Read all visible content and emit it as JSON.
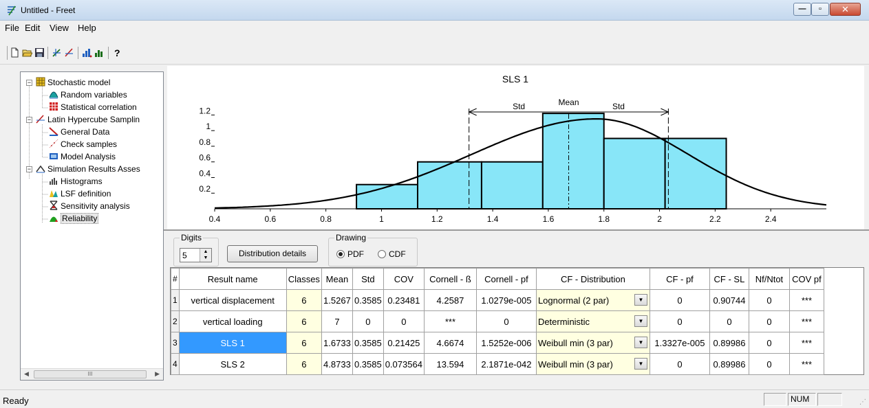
{
  "window": {
    "title": "Untitled - Freet",
    "minimize_glyph": "—",
    "maximize_glyph": "▫",
    "close_glyph": "✕"
  },
  "menu": [
    "File",
    "Edit",
    "View",
    "Help"
  ],
  "toolbar": {
    "icons": [
      "new-file-icon",
      "open-folder-icon",
      "save-disk-icon",
      "lhs-sampling-icon",
      "check-samples-icon",
      "histogram-icon",
      "sensitivity-icon",
      "help-icon"
    ]
  },
  "tree": {
    "items": [
      {
        "label": "Stochastic model",
        "icon": "grid-table-icon"
      },
      {
        "label": "Random variables",
        "icon": "pdf-curve-icon"
      },
      {
        "label": "Statistical correlation",
        "icon": "correlation-matrix-icon"
      },
      {
        "label": "Latin Hypercube Samplin",
        "icon": "lhs-icon"
      },
      {
        "label": "General Data",
        "icon": "general-data-icon"
      },
      {
        "label": "Check samples",
        "icon": "scatter-icon"
      },
      {
        "label": "Model Analysis",
        "icon": "model-analysis-icon"
      },
      {
        "label": "Simulation Results Asses",
        "icon": "results-icon"
      },
      {
        "label": "Histograms",
        "icon": "histogram-icon"
      },
      {
        "label": "LSF definition",
        "icon": "lsf-icon"
      },
      {
        "label": "Sensitivity analysis",
        "icon": "sensitivity-icon"
      },
      {
        "label": "Reliability",
        "icon": "reliability-icon"
      }
    ],
    "scroll_thumb": "III"
  },
  "chart_data": {
    "type": "bar",
    "title": "SLS 1",
    "xlim": [
      0.4,
      2.6
    ],
    "ylim": [
      0,
      1.3
    ],
    "x_ticks": [
      "0.4",
      "0.6",
      "0.8",
      "1",
      "1.2",
      "1.4",
      "1.6",
      "1.8",
      "2",
      "2.2",
      "2.4"
    ],
    "y_ticks": [
      "0.2",
      "0.4",
      "0.6",
      "0.8",
      "1",
      "1.2"
    ],
    "bins": [
      {
        "x0": 0.91,
        "x1": 1.13,
        "height": 0.31
      },
      {
        "x0": 1.13,
        "x1": 1.36,
        "height": 0.6
      },
      {
        "x0": 1.36,
        "x1": 1.58,
        "height": 0.6
      },
      {
        "x0": 1.58,
        "x1": 1.8,
        "height": 1.22
      },
      {
        "x0": 1.8,
        "x1": 2.02,
        "height": 0.9
      },
      {
        "x0": 2.02,
        "x1": 2.24,
        "height": 0.9
      }
    ],
    "mean": 1.6733,
    "std": 0.3585,
    "annotations": {
      "mean_label": "Mean",
      "std_label": "Std"
    },
    "pdf_curve": "Weibull min (3 par)",
    "bar_color": "#88e6f8"
  },
  "controls": {
    "digits_label": "Digits",
    "digits_value": "5",
    "details_button": "Distribution details",
    "drawing_label": "Drawing",
    "options": [
      {
        "label": "PDF",
        "selected": true
      },
      {
        "label": "CDF",
        "selected": false
      }
    ]
  },
  "grid": {
    "columns": [
      "#",
      "Result name",
      "Classes",
      "Mean",
      "Std",
      "COV",
      "Cornell - ß",
      "Cornell - pf",
      "CF - Distribution",
      "CF - pf",
      "CF - SL",
      "Nf/Ntot",
      "COV pf"
    ],
    "rows": [
      [
        "1",
        "vertical displacement",
        "6",
        "1.5267",
        "0.3585",
        "0.23481",
        "4.2587",
        "1.0279e-005",
        "Lognormal (2 par)",
        "0",
        "0.90744",
        "0",
        "***"
      ],
      [
        "2",
        "vertical loading",
        "6",
        "7",
        "0",
        "0",
        "***",
        "0",
        "Deterministic",
        "0",
        "0",
        "0",
        "***"
      ],
      [
        "3",
        "SLS 1",
        "6",
        "1.6733",
        "0.3585",
        "0.21425",
        "4.6674",
        "1.5252e-006",
        "Weibull min (3 par)",
        "1.3327e-005",
        "0.89986",
        "0",
        "***"
      ],
      [
        "4",
        "SLS 2",
        "6",
        "4.8733",
        "0.3585",
        "0.073564",
        "13.594",
        "2.1871e-042",
        "Weibull min (3 par)",
        "0",
        "0.89986",
        "0",
        "***"
      ]
    ],
    "selected_row": 2
  },
  "status": {
    "text": "Ready",
    "indicators": [
      "",
      "NUM",
      ""
    ]
  }
}
